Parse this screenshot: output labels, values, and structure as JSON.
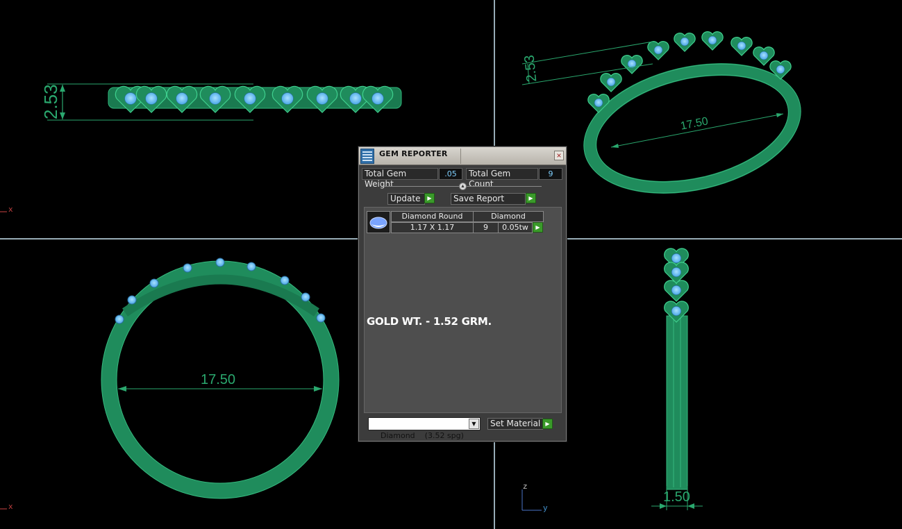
{
  "viewports": {
    "top_left": {
      "dimension": "2.53",
      "axis": "x"
    },
    "top_right": {
      "dimension_a": "2.53",
      "dimension_b": "17.50"
    },
    "bottom_left": {
      "dimension": "17.50",
      "axis": "x"
    },
    "bottom_right": {
      "dimension": "1.50",
      "axis_z": "z",
      "axis_y": "y"
    }
  },
  "gem_reporter": {
    "title": "GEM REPORTER",
    "close_symbol": "×",
    "total_weight_label": "Total Gem Weight",
    "total_weight_value": ".05",
    "total_count_label": "Total Gem Count",
    "total_count_value": "9",
    "update_label": "Update",
    "save_report_label": "Save Report",
    "gem_row": {
      "shape": "Diamond Round",
      "material": "Diamond",
      "size": "1.17 X 1.17",
      "count": "9",
      "weight": "0.05tw"
    },
    "note": "GOLD WT. - 1.52 GRM.",
    "material_select": "Diamond    (3.52 spg)",
    "set_material_label": "Set Material"
  },
  "colors": {
    "ring_green": "#1f8c5c",
    "gem_blue": "#6fc4ff",
    "viewport_divider": "#c9e6f2",
    "arrow_green": "#3a9a2a"
  }
}
